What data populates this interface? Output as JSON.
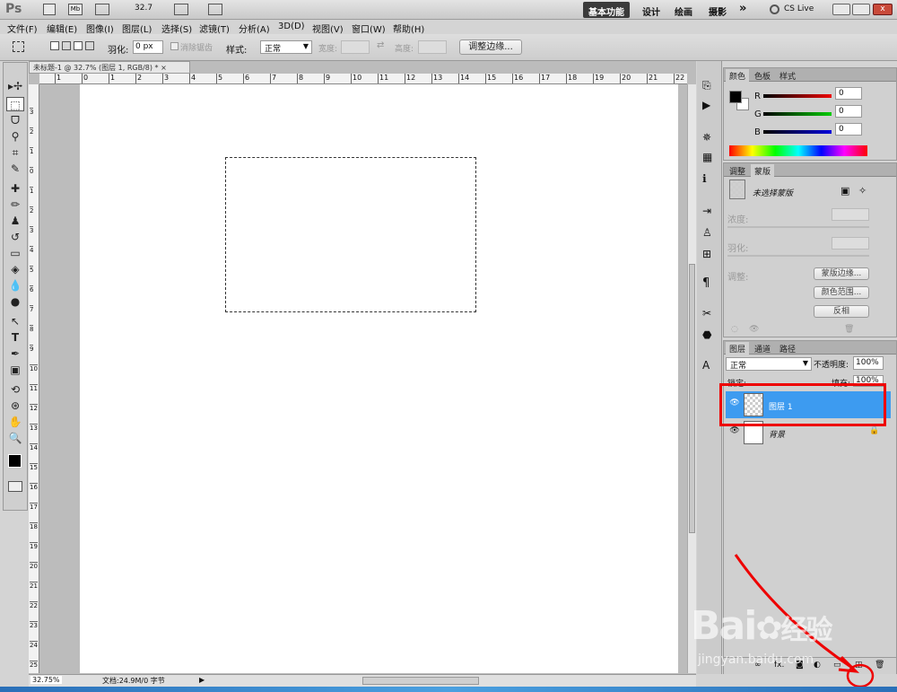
{
  "app": {
    "logo": "Ps",
    "zoom_combo": "32.7",
    "workspaces": [
      "基本功能",
      "设计",
      "绘画",
      "摄影"
    ],
    "more": "»",
    "cslive": "CS Live"
  },
  "menu": [
    "文件(F)",
    "编辑(E)",
    "图像(I)",
    "图层(L)",
    "选择(S)",
    "滤镜(T)",
    "分析(A)",
    "3D(D)",
    "视图(V)",
    "窗口(W)",
    "帮助(H)"
  ],
  "options": {
    "feather_label": "羽化:",
    "feather_value": "0 px",
    "antialias_label": "消除锯齿",
    "style_label": "样式:",
    "style_value": "正常",
    "width_label": "宽度:",
    "height_label": "高度:",
    "refine_button": "调整边缘..."
  },
  "document": {
    "tab_title": "未标题-1 @ 32.7% (图层 1, RGB/8) *",
    "close": "×",
    "ruler_h": [
      "1",
      "0",
      "1",
      "2",
      "3",
      "4",
      "5",
      "6",
      "7",
      "8",
      "9",
      "10",
      "11",
      "12",
      "13",
      "14",
      "15",
      "16",
      "17",
      "18",
      "19",
      "20",
      "21",
      "22"
    ],
    "ruler_v": [
      "3",
      "2",
      "1",
      "0",
      "1",
      "2",
      "3",
      "4",
      "5",
      "6",
      "7",
      "8",
      "9",
      "10",
      "11",
      "12",
      "13",
      "14",
      "15",
      "16",
      "17",
      "18",
      "19",
      "20",
      "21",
      "22",
      "23",
      "24",
      "25"
    ]
  },
  "status": {
    "zoom": "32.75%",
    "doc_info": "文档:24.9M/0 字节"
  },
  "color_panel": {
    "tabs": [
      "颜色",
      "色板",
      "样式"
    ],
    "channels": [
      {
        "label": "R",
        "value": "0",
        "color": "#d01010"
      },
      {
        "label": "G",
        "value": "0",
        "color": "#10b010"
      },
      {
        "label": "B",
        "value": "0",
        "color": "#1010c0"
      }
    ]
  },
  "mask_panel": {
    "tabs": [
      "调整",
      "蒙版"
    ],
    "no_mask": "未选择蒙版",
    "density_label": "浓度:",
    "feather_label": "羽化:",
    "adjust_label": "调整:",
    "btn_mask_edge": "蒙版边缘...",
    "btn_color_range": "颜色范围...",
    "btn_invert": "反相"
  },
  "layers_panel": {
    "tabs": [
      "图层",
      "通道",
      "路径"
    ],
    "blend_mode": "正常",
    "opacity_label": "不透明度:",
    "opacity_value": "100%",
    "lock_label": "锁定:",
    "fill_label": "填充:",
    "fill_value": "100%",
    "layers": [
      {
        "name": "图层 1",
        "selected": true
      },
      {
        "name": "背景",
        "selected": false
      }
    ]
  },
  "watermark": {
    "brand": "Bai",
    "brand2": "经验",
    "url": "jingyan.baidu.com"
  },
  "colors": {
    "accent": "#3d9bf0",
    "annotation": "#ff0000"
  }
}
